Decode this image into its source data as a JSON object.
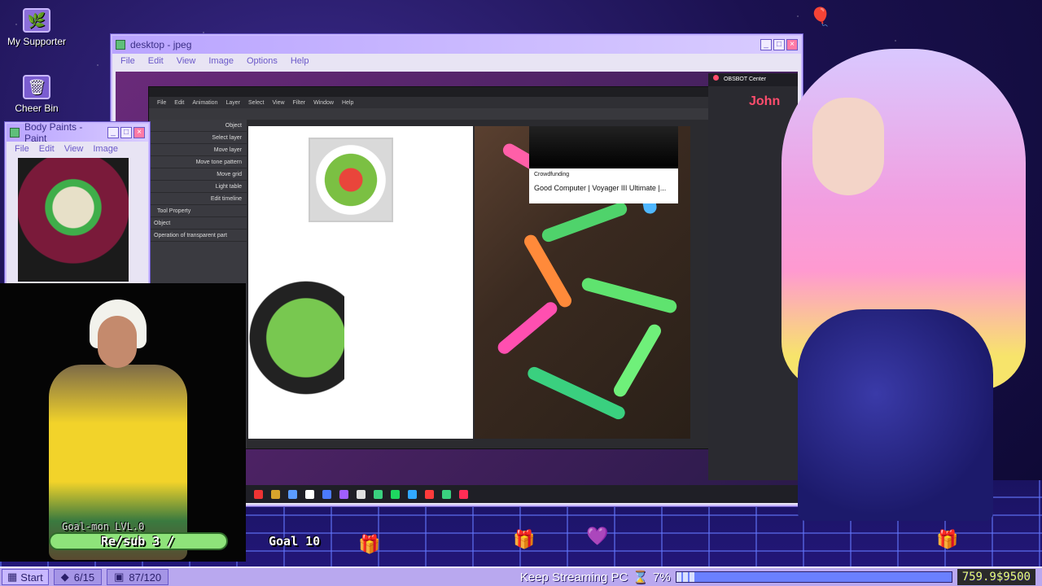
{
  "desktop": {
    "icons": [
      {
        "label": "My Supporter",
        "icon": "monitor-icon"
      },
      {
        "label": "Cheer Bin",
        "icon": "bin-icon"
      }
    ]
  },
  "main_window": {
    "title": "desktop - jpeg",
    "menu": [
      "File",
      "Edit",
      "View",
      "Image",
      "Options",
      "Help"
    ]
  },
  "paint_window": {
    "title": "Body Paints - Paint",
    "menu": [
      "File",
      "Edit",
      "View",
      "Image"
    ]
  },
  "clip_studio": {
    "menu": [
      "File",
      "Edit",
      "Animation",
      "Layer",
      "Select",
      "View",
      "Filter",
      "Window",
      "Help"
    ],
    "tool_panel": [
      "Object",
      "Select layer",
      "Move layer",
      "Move tone pattern",
      "Move grid",
      "Light table",
      "Edit timeline"
    ],
    "tool_property_label": "Tool Property",
    "property_object": "Object",
    "property_operation": "Operation of transparent part"
  },
  "ad": {
    "small": "Crowdfunding",
    "title": "Good Computer | Voyager III Ultimate |..."
  },
  "obs": {
    "title": "OBSBOT Center",
    "name_overlay": "John"
  },
  "webcam": {
    "goal_name": "Goal-mon LVL.0",
    "resub": "Re/sub 3 /",
    "goal": "Goal 10"
  },
  "taskbar": {
    "start": "Start",
    "counter1": "6/15",
    "counter2": "87/120",
    "ticker_label": "Keep Streaming PC",
    "percent": "7%",
    "percent_value": 7,
    "money": "759.9$9500"
  },
  "colors": {
    "accent": "#b9a4ff",
    "bar": "#b9a8ef"
  }
}
